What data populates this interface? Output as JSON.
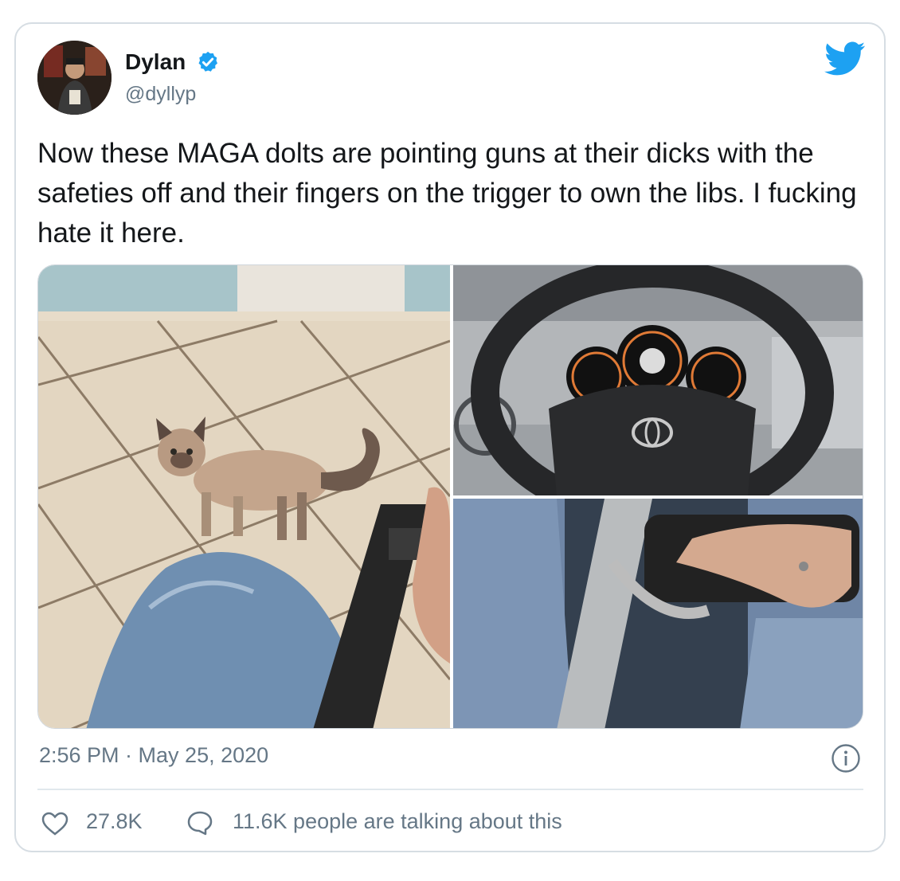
{
  "author": {
    "name": "Dylan",
    "handle": "@dyllyp",
    "verified": true,
    "avatar_icon": "avatar-photo"
  },
  "tweet": {
    "text": "Now these MAGA dolts are pointing guns at their dicks with the safeties off and their fingers on the trigger to own the libs. I fucking hate it here.",
    "timestamp": "2:56 PM · May 25, 2020"
  },
  "media": {
    "photos": [
      "cat-and-pistol-photo",
      "steering-wheel-photo",
      "silver-pistol-photo"
    ]
  },
  "actions": {
    "likes": "27.8K",
    "talking": "11.6K people are talking about this"
  },
  "icons": {
    "brand": "twitter-bird-icon",
    "info": "info-icon",
    "like": "heart-icon",
    "reply": "reply-bubble-icon"
  },
  "colors": {
    "brand": "#1da1f2",
    "text": "#14171a",
    "secondary": "#657786",
    "border": "#d6dde3"
  }
}
